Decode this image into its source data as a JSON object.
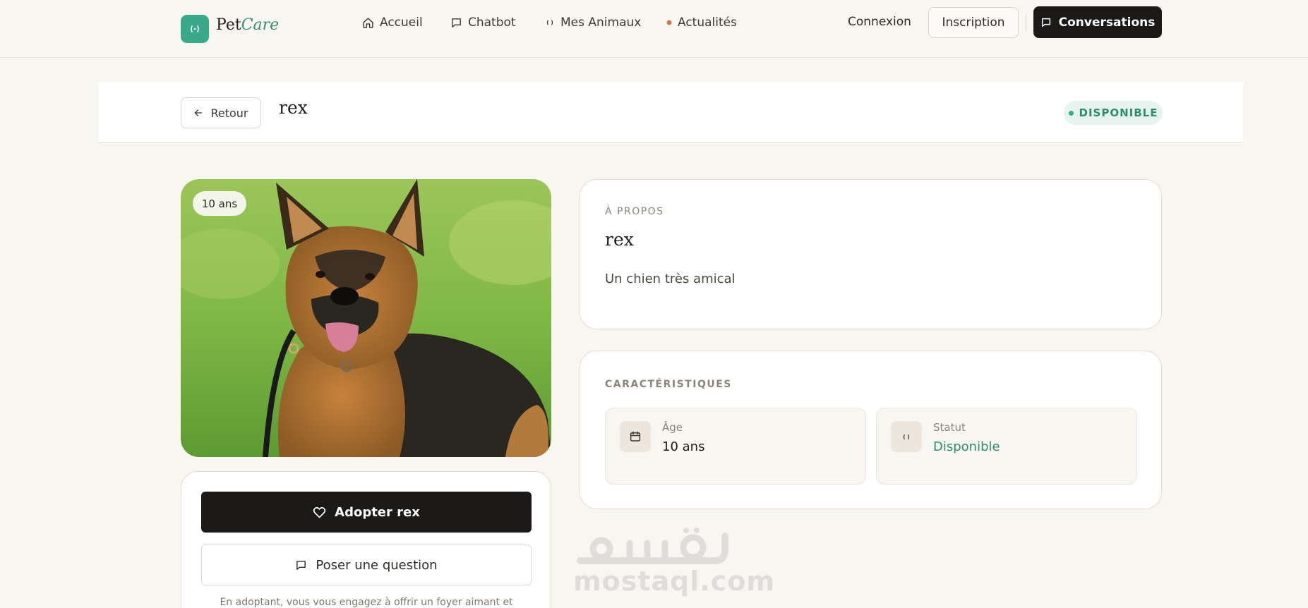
{
  "header": {
    "brand_pet": "Pet",
    "brand_care": "Care",
    "nav": [
      {
        "label": "Accueil",
        "icon": "home-icon"
      },
      {
        "label": "Chatbot",
        "icon": "chat-bubble-icon"
      },
      {
        "label": "Mes Animaux",
        "icon": "paw-icon"
      },
      {
        "label": "Actualités",
        "icon": "dot-icon"
      }
    ],
    "login_label": "Connexion",
    "signup_label": "Inscription",
    "conversations_label": "Conversations"
  },
  "subheader": {
    "back_label": "Retour",
    "title": "rex",
    "status_badge": "DISPONIBLE"
  },
  "photo": {
    "age_chip": "10 ans"
  },
  "actions": {
    "adopt_label": "Adopter rex",
    "question_label": "Poser une question",
    "note": "En adoptant, vous vous engagez à offrir un foyer aimant et"
  },
  "about": {
    "section_label": "À PROPOS",
    "name": "rex",
    "description": "Un chien très amical"
  },
  "features": {
    "section_label": "CARACTÉRISTIQUES",
    "items": [
      {
        "key": "Âge",
        "value": "10 ans",
        "icon": "calendar-icon"
      },
      {
        "key": "Statut",
        "value": "Disponible",
        "icon": "paw-icon"
      }
    ]
  },
  "watermark": {
    "arabic": "مستقل",
    "latin": "mostaql.com"
  },
  "colors": {
    "accent": "#3aa98a",
    "accent_dark": "#2f8c6f",
    "background": "#f8f6f1",
    "primary_button": "#1b1a18"
  }
}
